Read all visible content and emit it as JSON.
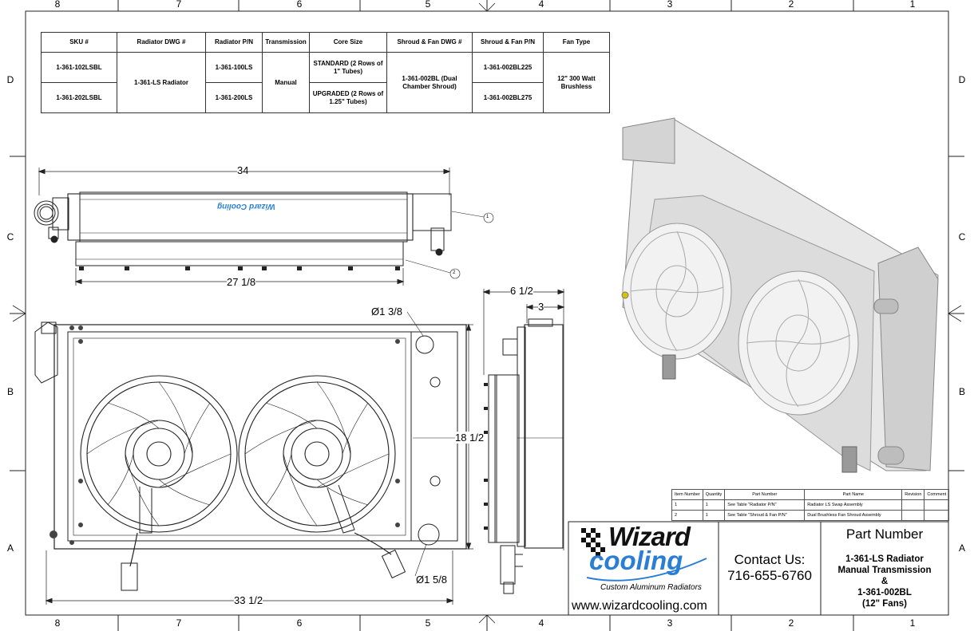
{
  "zones": {
    "top": [
      "8",
      "7",
      "6",
      "5",
      "4",
      "3",
      "2",
      "1"
    ],
    "bottom": [
      "8",
      "7",
      "6",
      "5",
      "4",
      "3",
      "2",
      "1"
    ],
    "left": [
      "D",
      "C",
      "B",
      "A"
    ],
    "right": [
      "D",
      "C",
      "B",
      "A"
    ]
  },
  "spec_table": {
    "headers": [
      "SKU #",
      "Radiator DWG #",
      "Radiator P/N",
      "Transmission",
      "Core Size",
      "Shroud & Fan DWG #",
      "Shroud & Fan P/N",
      "Fan Type"
    ],
    "rows": [
      {
        "sku": "1-361-102LSBL",
        "radiator_pn": "1-361-100LS",
        "core_size": "STANDARD (2 Rows of 1\" Tubes)",
        "shroud_pn": "1-361-002BL225"
      },
      {
        "sku": "1-361-202LSBL",
        "radiator_pn": "1-361-200LS",
        "core_size": "UPGRADED (2 Rows of 1.25\" Tubes)",
        "shroud_pn": "1-361-002BL275"
      }
    ],
    "radiator_dwg": "1-361-LS Radiator",
    "transmission": "Manual",
    "shroud_dwg": "1-361-002BL (Dual Chamber Shroud)",
    "fan_type": "12\" 300 Watt Brushless"
  },
  "dimensions": {
    "top_width": "34",
    "top_core": "27 1/8",
    "front_width": "33 1/2",
    "front_height": "18 1/2",
    "side_depth": "6 1/2",
    "side_shroud": "3",
    "inlet_dia": "Ø1 3/8",
    "outlet_dia": "Ø1 5/8"
  },
  "balloons": [
    "1",
    "2"
  ],
  "logo_top_view": "Wizard Cooling",
  "bom": {
    "headers": [
      "Item Number",
      "Quantity",
      "Part Number",
      "Part Name",
      "Revision",
      "Comment"
    ],
    "rows": [
      [
        "1",
        "1",
        "See Table \"Radiator P/N\"",
        "Radiator LS Swap Assembly",
        "",
        ""
      ],
      [
        "2",
        "1",
        "See Table \"Shroud & Fan P/N\"",
        "Dual Brushless Fan Shroud Assembly",
        "",
        ""
      ]
    ]
  },
  "title_block": {
    "logo_word1": "Wizard",
    "logo_word2": "cooling",
    "tagline": "Custom Aluminum Radiators",
    "website": "www.wizardcooling.com",
    "contact_label": "Contact Us:",
    "phone": "716-655-6760",
    "part_number_label": "Part Number",
    "part_lines": [
      "1-361-LS Radiator",
      "Manual Transmission",
      "&",
      "1-361-002BL",
      "(12\" Fans)"
    ]
  },
  "colors": {
    "line": "#222222",
    "logo_blue": "#2a7fd4",
    "iso_light": "#e4e4e4",
    "iso_mid": "#c9c9c9",
    "iso_dark": "#9a9a9a"
  }
}
